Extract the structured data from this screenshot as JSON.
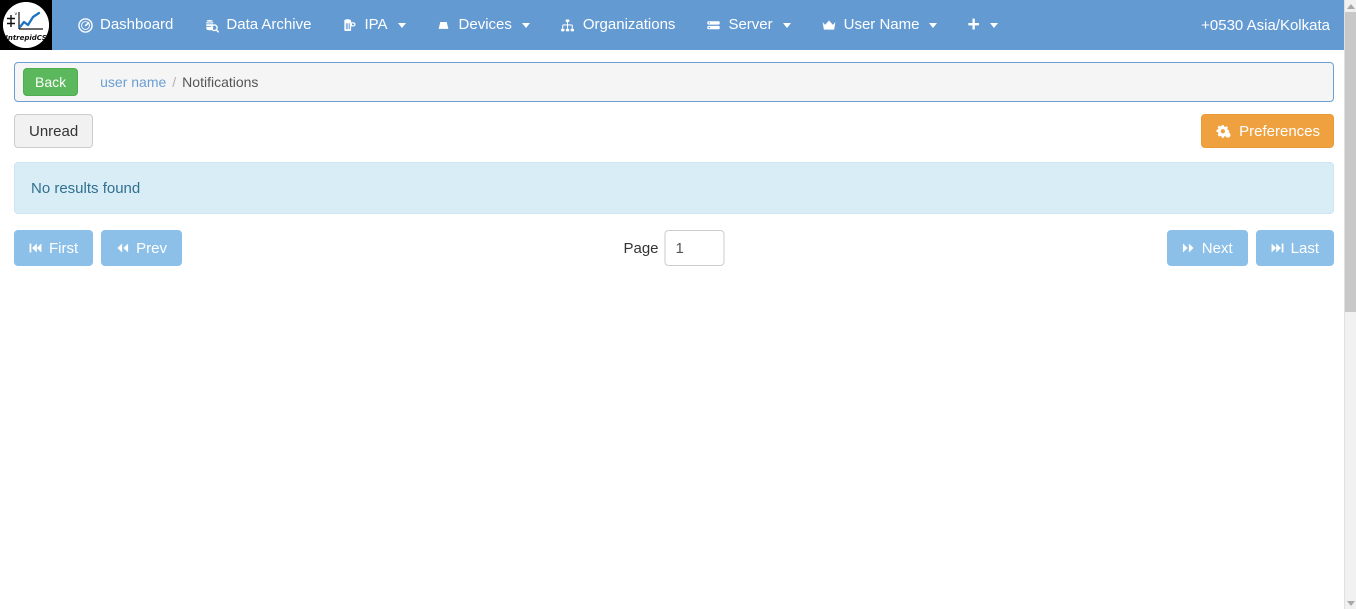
{
  "navbar": {
    "brand": {
      "name": "intrepidcs-logo",
      "text": "IntrepidCS"
    },
    "items": [
      {
        "label": "Dashboard",
        "icon": "dashboard-icon",
        "caret": false
      },
      {
        "label": "Data Archive",
        "icon": "data-archive-icon",
        "caret": false
      },
      {
        "label": "IPA",
        "icon": "beer-mug-icon",
        "caret": true
      },
      {
        "label": "Devices",
        "icon": "hdd-icon",
        "caret": true
      },
      {
        "label": "Organizations",
        "icon": "sitemap-icon",
        "caret": false
      },
      {
        "label": "Server",
        "icon": "server-icon",
        "caret": true
      },
      {
        "label": "User Name",
        "icon": "crown-icon",
        "caret": true
      },
      {
        "label": "",
        "icon": "plus-icon",
        "caret": true
      }
    ],
    "timezone": "+0530 Asia/Kolkata"
  },
  "breadcrumb": {
    "back_label": "Back",
    "link_label": "user name",
    "separator": "/",
    "current_label": "Notifications"
  },
  "toolbar": {
    "unread_label": "Unread",
    "preferences_label": "Preferences",
    "preferences_icon": "cogs-icon"
  },
  "alert": {
    "message": "No results found"
  },
  "pager": {
    "first_label": "First",
    "first_icon": "step-backward-icon",
    "prev_label": "Prev",
    "prev_icon": "fast-backward-icon",
    "page_label": "Page",
    "page_value": "1",
    "page_placeholder": "",
    "next_label": "Next",
    "next_icon": "fast-forward-icon",
    "last_label": "Last",
    "last_icon": "step-forward-icon"
  },
  "colors": {
    "navbar": "#649ad2",
    "back_button": "#5cb85c",
    "preferences_button": "#efa140",
    "pager_button": "#8cc0e8",
    "alert_bg": "#d9edf7",
    "alert_text": "#31708f",
    "link": "#6b9fd4"
  }
}
